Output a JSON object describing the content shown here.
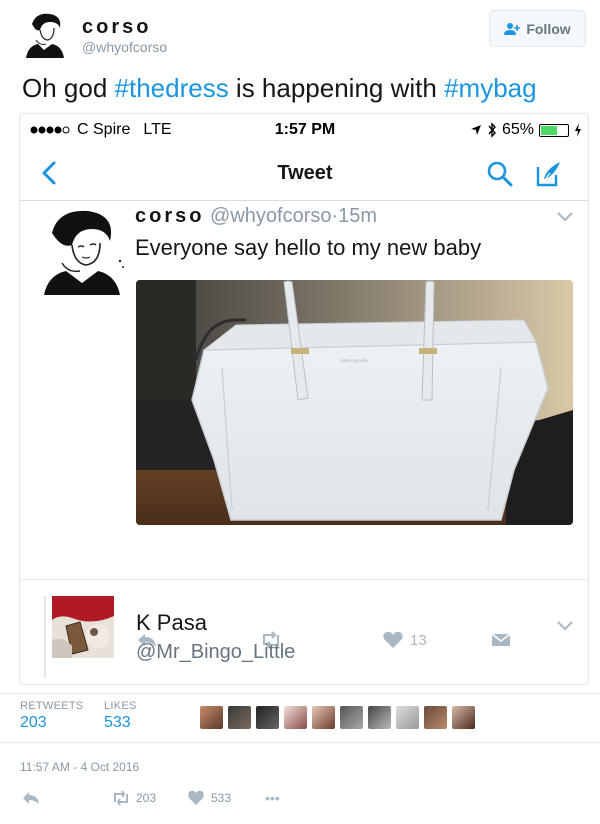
{
  "outer": {
    "name": "corso",
    "handle": "@whyofcorso",
    "follow_label": "Follow",
    "tweet_prefix": "Oh god ",
    "hashtag1": "#thedress",
    "tweet_middle": " is happening with ",
    "hashtag2": "#mybag"
  },
  "status_bar": {
    "carrier": "C Spire",
    "network": "LTE",
    "time": "1:57 PM",
    "battery": "65%",
    "battery_level": 0.65
  },
  "nav": {
    "title": "Tweet"
  },
  "inner_tweet": {
    "name": "corso",
    "handle": "@whyofcorso",
    "age": "15m",
    "text": "Everyone say hello to my new baby",
    "likes": "13"
  },
  "quoted": {
    "name": "K Pasa",
    "handle": "@Mr_Bingo_Little"
  },
  "stats": {
    "retweets_label": "RETWEETS",
    "retweets": "203",
    "likes_label": "LIKES",
    "likes": "533"
  },
  "timestamp": "11:57 AM - 4 Oct 2016",
  "bottom": {
    "retweets": "203",
    "likes": "533",
    "more": "•••"
  },
  "colors": {
    "link": "#1b95e0",
    "muted": "#8899a6",
    "battery_green": "#4cd964"
  }
}
